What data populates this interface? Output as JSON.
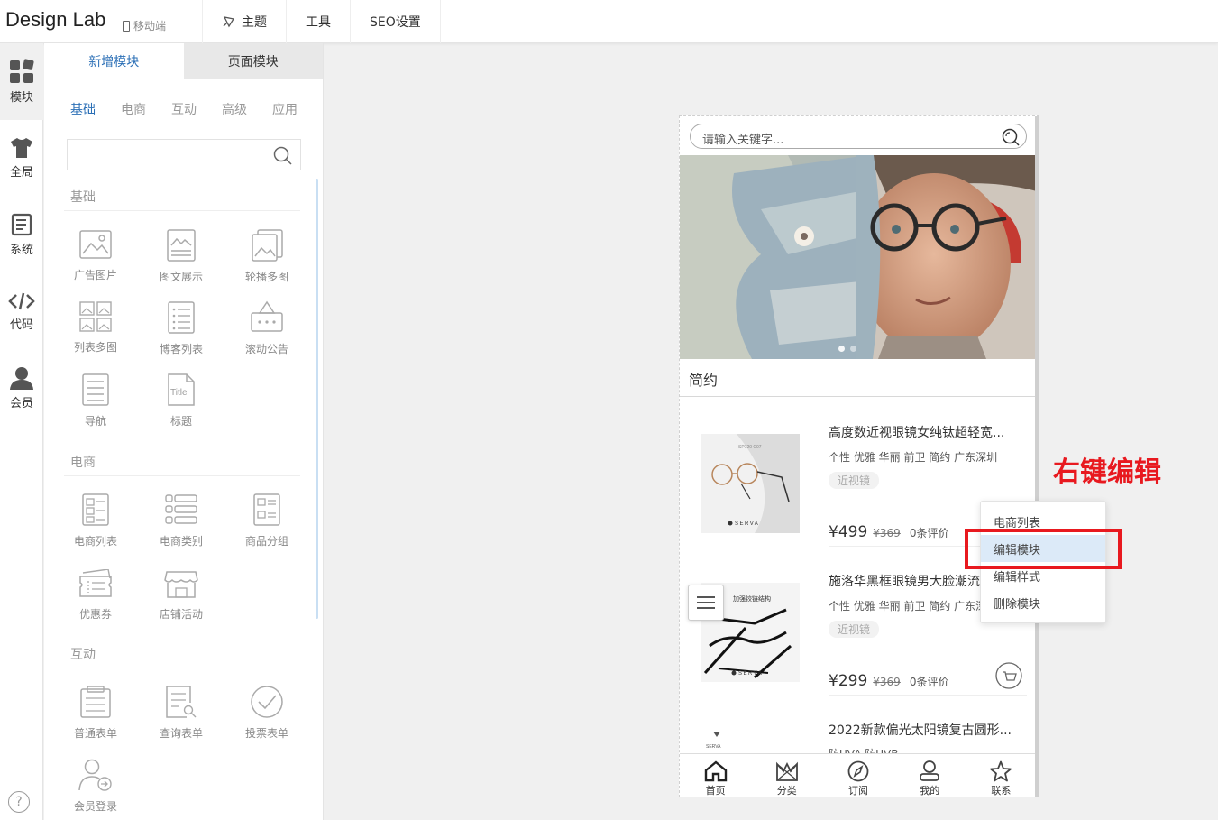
{
  "topbar": {
    "logo": "Design Lab",
    "mobile_label": "移动端",
    "nav": [
      {
        "label": "主题",
        "icon": "theme-icon"
      },
      {
        "label": "工具"
      },
      {
        "label": "SEO设置"
      }
    ]
  },
  "rail": [
    {
      "label": "模块",
      "icon": "modules-icon",
      "active": true
    },
    {
      "label": "全局",
      "icon": "shirt-icon"
    },
    {
      "label": "系统",
      "icon": "document-icon"
    },
    {
      "label": "代码",
      "icon": "code-icon"
    },
    {
      "label": "会员",
      "icon": "user-icon"
    }
  ],
  "help_label": "?",
  "panel": {
    "tabs": [
      "新增模块",
      "页面模块"
    ],
    "categories": [
      "基础",
      "电商",
      "互动",
      "高级",
      "应用"
    ],
    "sections": [
      {
        "title": "基础",
        "modules": [
          "广告图片",
          "图文展示",
          "轮播多图",
          "列表多图",
          "博客列表",
          "滚动公告",
          "导航",
          "标题"
        ]
      },
      {
        "title": "电商",
        "modules": [
          "电商列表",
          "电商类别",
          "商品分组",
          "优惠券",
          "店铺活动"
        ]
      },
      {
        "title": "互动",
        "modules": [
          "普通表单",
          "查询表单",
          "投票表单",
          "会员登录"
        ]
      }
    ],
    "title_icon_text": "Title"
  },
  "preview": {
    "search_placeholder": "请输入关键字...",
    "section_title": "简约",
    "products": [
      {
        "name": "高度数近视眼镜女纯钛超轻宽...",
        "tags": "个性 优雅 华丽 前卫 简约  广东深圳",
        "chip": "近视镜",
        "price": "¥499",
        "old_price": "¥369",
        "reviews": "0条评价",
        "brand": "SERVA",
        "model": "SP720 C07"
      },
      {
        "name": "施洛华黑框眼镜男大脸潮流...",
        "tags": "个性 优雅 华丽 前卫 简约  广东深圳",
        "chip": "近视镜",
        "price": "¥299",
        "old_price": "¥369",
        "reviews": "0条评价",
        "brand": "SERVA",
        "model": "加强铰链结构"
      },
      {
        "name": "2022新款偏光太阳镜复古圆形...",
        "tags": "防UVA 防UVB",
        "brand": "SERVA"
      }
    ],
    "bottom_nav": [
      {
        "label": "首页",
        "icon": "home-icon"
      },
      {
        "label": "分类",
        "icon": "crown-icon"
      },
      {
        "label": "订阅",
        "icon": "compass-icon"
      },
      {
        "label": "我的",
        "icon": "user-icon"
      },
      {
        "label": "联系",
        "icon": "star-icon"
      }
    ]
  },
  "context_menu": [
    "电商列表",
    "编辑模块",
    "编辑样式",
    "删除模块"
  ],
  "annotation": "右键编辑",
  "colors": {
    "accent": "#2b6fb6",
    "annotation": "#e8191f",
    "highlight": "#dceaf8"
  }
}
